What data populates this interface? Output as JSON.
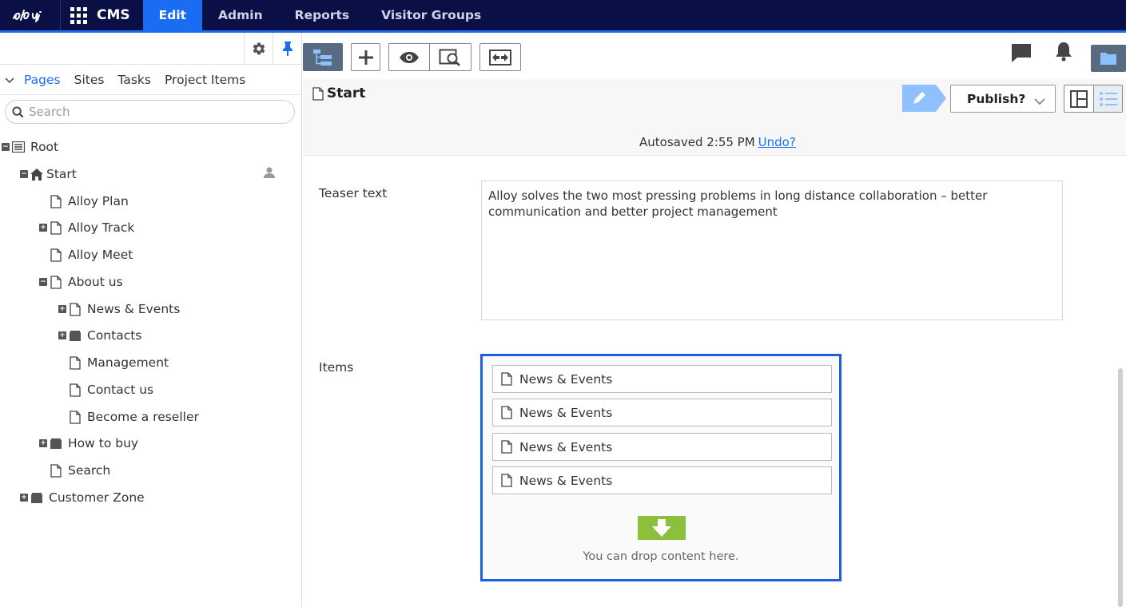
{
  "topnav": {
    "product": "CMS",
    "tabs": [
      {
        "label": "Edit",
        "active": true
      },
      {
        "label": "Admin",
        "active": false
      },
      {
        "label": "Reports",
        "active": false
      },
      {
        "label": "Visitor Groups",
        "active": false
      }
    ]
  },
  "navtree": {
    "tabs": [
      {
        "label": "Pages",
        "active": true
      },
      {
        "label": "Sites",
        "active": false
      },
      {
        "label": "Tasks",
        "active": false
      },
      {
        "label": "Project Items",
        "active": false
      }
    ],
    "search_placeholder": "Search",
    "items": [
      {
        "label": "Root",
        "toggle": "minus",
        "icon": "root-list-icon"
      },
      {
        "label": "Start",
        "toggle": "minus",
        "icon": "home-icon"
      },
      {
        "label": "Alloy Plan",
        "toggle": "none",
        "icon": "page-icon"
      },
      {
        "label": "Alloy Track",
        "toggle": "plus",
        "icon": "page-icon"
      },
      {
        "label": "Alloy Meet",
        "toggle": "none",
        "icon": "page-icon"
      },
      {
        "label": "About us",
        "toggle": "minus",
        "icon": "page-icon"
      },
      {
        "label": "News & Events",
        "toggle": "plus",
        "icon": "page-icon"
      },
      {
        "label": "Contacts",
        "toggle": "plus",
        "icon": "container-icon"
      },
      {
        "label": "Management",
        "toggle": "none",
        "icon": "page-icon"
      },
      {
        "label": "Contact us",
        "toggle": "none",
        "icon": "page-icon"
      },
      {
        "label": "Become a reseller",
        "toggle": "none",
        "icon": "page-icon"
      },
      {
        "label": "How to buy",
        "toggle": "plus",
        "icon": "container-icon"
      },
      {
        "label": "Search",
        "toggle": "none",
        "icon": "page-icon"
      },
      {
        "label": "Customer Zone",
        "toggle": "plus",
        "icon": "container-icon"
      }
    ]
  },
  "page": {
    "title": "Start",
    "publish_label": "Publish?",
    "autosave_text": "Autosaved 2:55 PM",
    "undo_label": "Undo?"
  },
  "form": {
    "teaser_label": "Teaser text",
    "teaser_value": "Alloy solves the two most pressing problems in long distance collaboration – better communication and better project management",
    "items_label": "Items",
    "items": [
      {
        "label": "News & Events"
      },
      {
        "label": "News & Events"
      },
      {
        "label": "News & Events"
      },
      {
        "label": "News & Events"
      }
    ],
    "drop_text": "You can drop content here."
  },
  "colors": {
    "nav_bg": "#0a0f45",
    "accent": "#1a6df3",
    "drop_green": "#8cbf3c",
    "toolbar_dark": "#596b80"
  }
}
